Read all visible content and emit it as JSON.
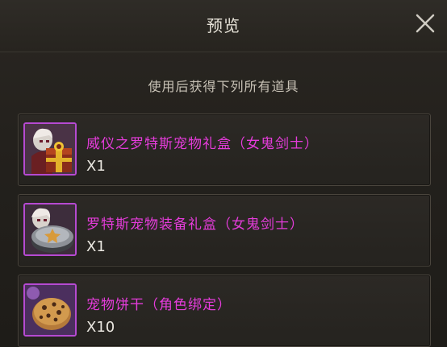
{
  "dialog": {
    "title": "预览",
    "subtitle": "使用后获得下列所有道具",
    "close_icon": "close-icon"
  },
  "items": [
    {
      "name": "威仪之罗特斯宠物礼盒（女鬼剑士）",
      "quantity": "X1",
      "icon": "pet-gift-box-icon",
      "rarity_color": "#e53cdb"
    },
    {
      "name": "罗特斯宠物装备礼盒（女鬼剑士）",
      "quantity": "X1",
      "icon": "pet-equipment-box-icon",
      "rarity_color": "#e53cdb"
    },
    {
      "name": "宠物饼干（角色绑定）",
      "quantity": "X10",
      "icon": "pet-cookie-icon",
      "rarity_color": "#e53cdb"
    }
  ]
}
